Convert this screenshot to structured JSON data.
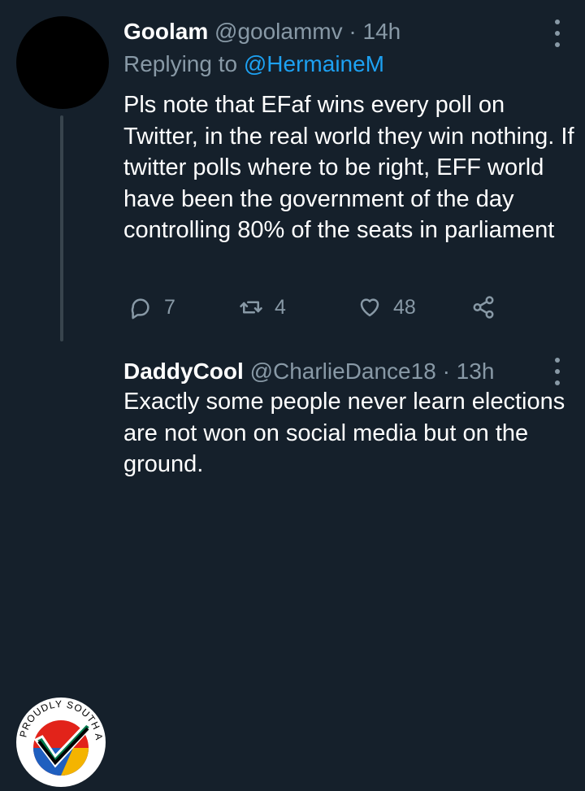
{
  "tweets": [
    {
      "name": "Goolam",
      "handle": "@goolammv",
      "dot": "·",
      "time": "14h",
      "replying_prefix": "Replying to",
      "replying_to": "@HermaineM",
      "text": "Pls note that EFaf wins every poll on Twitter, in the real world they win nothing. If twitter polls where to be right, EFF world have been the government of the day controlling 80% of the seats in parliament",
      "replies": "7",
      "retweets": "4",
      "likes": "48",
      "avatar_color": "#000000"
    },
    {
      "name": "DaddyCool",
      "handle": "@CharlieDance18",
      "dot": "·",
      "time": "13h",
      "text": "Exactly some people never learn elections are not won on social media but on the ground.",
      "avatar_text": "PROUDLY SOUTH AFRICAN"
    }
  ],
  "icons": {
    "reply": "reply-icon",
    "retweet": "retweet-icon",
    "like": "heart-icon",
    "share": "share-icon",
    "more": "more-options-icon"
  },
  "colors": {
    "background": "#15202b",
    "text": "#ffffff",
    "muted": "#8899a6",
    "link": "#1da1f2",
    "thread_line": "#38444d"
  }
}
